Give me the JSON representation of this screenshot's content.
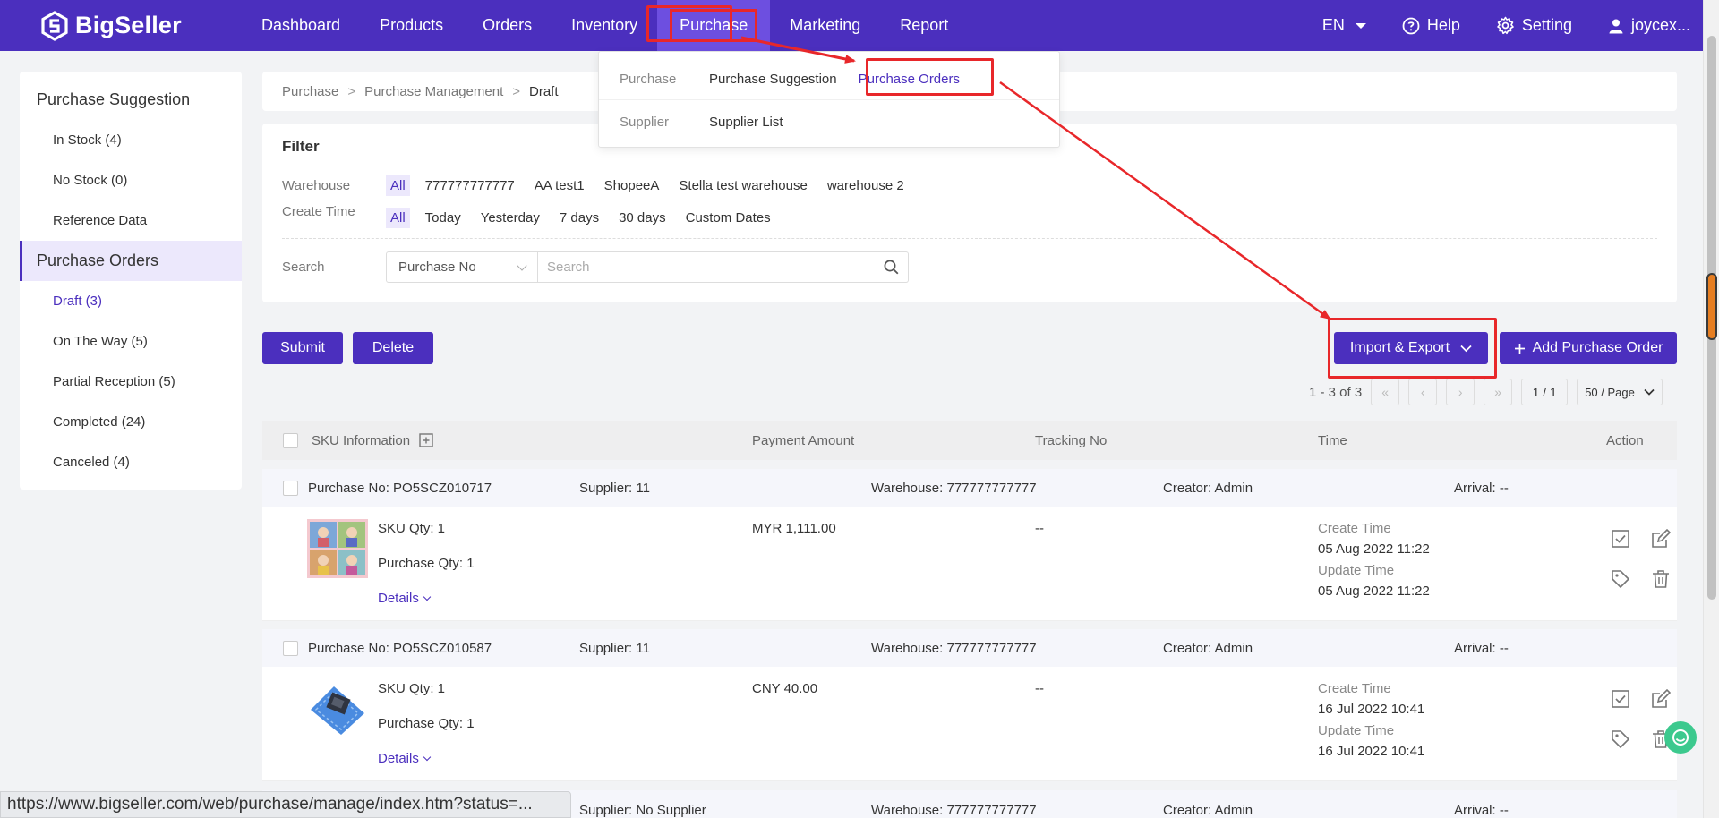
{
  "app": {
    "logo_text": "BigSeller"
  },
  "nav": {
    "items": [
      "Dashboard",
      "Products",
      "Orders",
      "Inventory",
      "Purchase",
      "Marketing",
      "Report"
    ],
    "language": "EN",
    "help": "Help",
    "setting": "Setting",
    "user": "joycex..."
  },
  "dropdown": {
    "purchase_label": "Purchase",
    "purchase_suggestion": "Purchase Suggestion",
    "purchase_orders": "Purchase Orders",
    "supplier_label": "Supplier",
    "supplier_list": "Supplier List"
  },
  "sidebar": {
    "group1": "Purchase Suggestion",
    "group1_items": [
      "In Stock (4)",
      "No Stock (0)",
      "Reference Data"
    ],
    "group2": "Purchase Orders",
    "group2_items": [
      "Draft (3)",
      "On The Way (5)",
      "Partial Reception (5)",
      "Completed (24)",
      "Canceled (4)"
    ]
  },
  "breadcrumb": {
    "a": "Purchase",
    "b": "Purchase Management",
    "c": "Draft",
    "sep": ">"
  },
  "filter": {
    "title": "Filter",
    "warehouse_label": "Warehouse",
    "warehouse_options": [
      "All",
      "777777777777",
      "AA test1",
      "ShopeeA",
      "Stella test warehouse",
      "warehouse 2"
    ],
    "time_label": "Create Time",
    "time_options": [
      "All",
      "Today",
      "Yesterday",
      "7 days",
      "30 days",
      "Custom Dates"
    ],
    "search_label": "Search",
    "search_type": "Purchase No",
    "search_placeholder": "Search"
  },
  "actions": {
    "submit": "Submit",
    "delete": "Delete",
    "import_export": "Import & Export",
    "add_order": "Add Purchase Order"
  },
  "pager": {
    "range": "1 - 3 of 3",
    "page": "1 / 1",
    "per_page": "50 / Page"
  },
  "table": {
    "headers": {
      "sku": "SKU Information",
      "payment": "Payment Amount",
      "tracking": "Tracking No",
      "time": "Time",
      "action": "Action"
    },
    "orders": [
      {
        "purchase_no": "Purchase No: PO5SCZ010717",
        "supplier": "Supplier: 11",
        "warehouse": "Warehouse: 777777777777",
        "creator": "Creator: Admin",
        "arrival": "Arrival: --",
        "sku_qty": "SKU Qty: 1",
        "purchase_qty": "Purchase Qty: 1",
        "details": "Details",
        "amount": "MYR 1,111.00",
        "tracking": "--",
        "create_label": "Create Time",
        "create_time": "05 Aug 2022 11:22",
        "update_label": "Update Time",
        "update_time": "05 Aug 2022 11:22"
      },
      {
        "purchase_no": "Purchase No: PO5SCZ010587",
        "supplier": "Supplier: 11",
        "warehouse": "Warehouse: 777777777777",
        "creator": "Creator: Admin",
        "arrival": "Arrival: --",
        "sku_qty": "SKU Qty: 1",
        "purchase_qty": "Purchase Qty: 1",
        "details": "Details",
        "amount": "CNY 40.00",
        "tracking": "--",
        "create_label": "Create Time",
        "create_time": "16 Jul 2022 10:41",
        "update_label": "Update Time",
        "update_time": "16 Jul 2022 10:41"
      },
      {
        "supplier": "Supplier: No Supplier",
        "warehouse": "Warehouse: 777777777777",
        "creator": "Creator: Admin",
        "arrival": "Arrival: --"
      }
    ]
  },
  "statusbar": {
    "url": "https://www.bigseller.com/web/purchase/manage/index.htm?status=..."
  },
  "colors": {
    "brand": "#4b2fbe",
    "highlight": "#e8272a",
    "active_bg": "#ece8fc"
  }
}
